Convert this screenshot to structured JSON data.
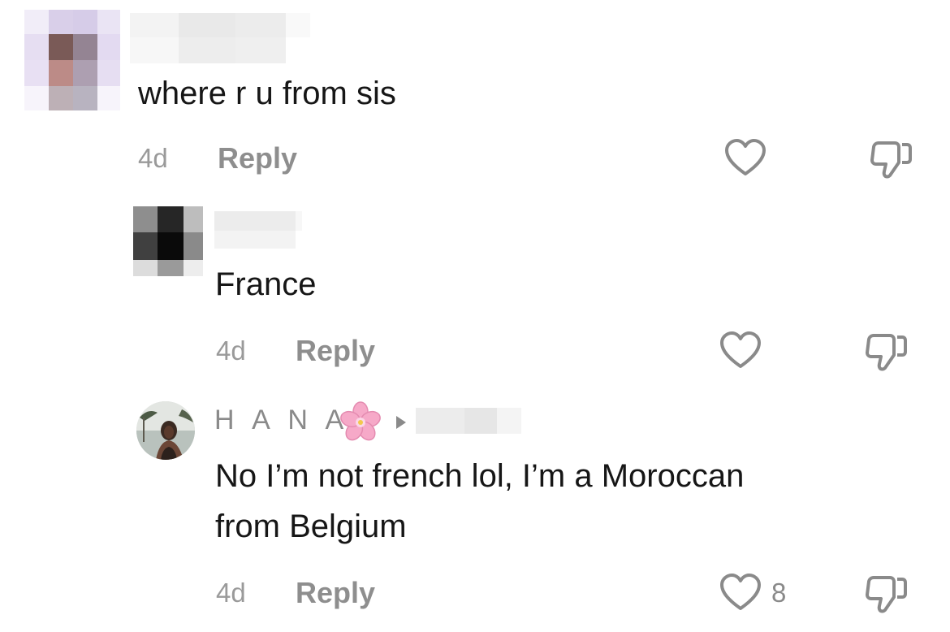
{
  "comments": [
    {
      "username": "",
      "text": "where r u from sis",
      "time": "4d",
      "reply_label": "Reply",
      "like_count": ""
    },
    {
      "username": "",
      "text": "France",
      "time": "4d",
      "reply_label": "Reply",
      "like_count": ""
    },
    {
      "username": "H A N A",
      "flower_emoji": "🌸",
      "reply_to_arrow": "▶",
      "text": "No I’m not french lol, I’m a Moroccan\nfrom Belgium",
      "time": "4d",
      "reply_label": "Reply",
      "like_count": "8"
    }
  ],
  "icons": {
    "like": "heart-outline-icon",
    "dislike": "thumbs-down-icon",
    "reply_arrow": "play-triangle-icon"
  },
  "colors": {
    "text_primary": "#161616",
    "text_muted": "#9a9a9a",
    "icon_stroke": "#8a8a8a",
    "hana_flower": "#f6a9c8"
  }
}
